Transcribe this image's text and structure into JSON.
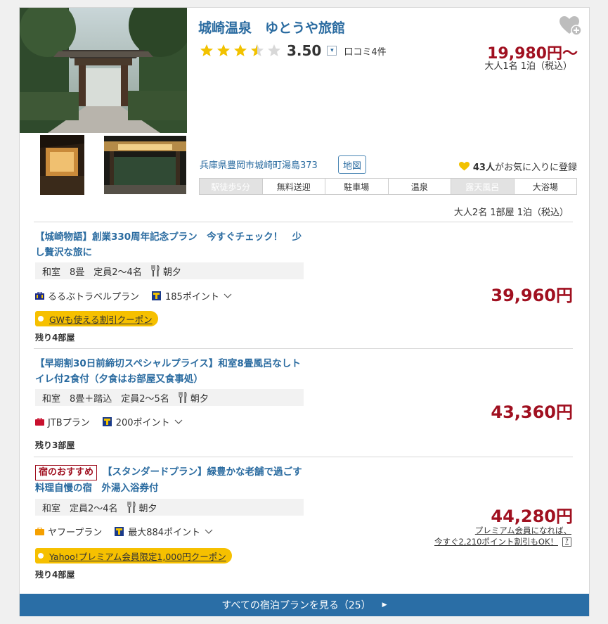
{
  "hotel": {
    "name": "城崎温泉　ゆとうや旅館",
    "rating": {
      "stars": 3.5,
      "score": "3.50",
      "dropdown_glyph": "▾",
      "reviews": "口コミ4件"
    },
    "price_from": "19,980円～",
    "price_note": "大人1名 1泊（税込）",
    "address": "兵庫県豊岡市城崎町湯島373",
    "map_label": "地図",
    "favorites": {
      "count": "43人",
      "suffix": "がお気に入りに登録"
    },
    "amenities": [
      {
        "label": "駅徒歩5分",
        "active": false
      },
      {
        "label": "無料送迎",
        "active": true
      },
      {
        "label": "駐車場",
        "active": true
      },
      {
        "label": "温泉",
        "active": true
      },
      {
        "label": "露天風呂",
        "active": false
      },
      {
        "label": "大浴場",
        "active": true
      }
    ]
  },
  "guest_note": "大人2名 1部屋 1泊（税込）",
  "plans": [
    {
      "badge": "",
      "title": "【城崎物語】創業330周年記念プラン　今すぐチェック！　少し贅沢な旅に",
      "room": "和室　8畳　定員2～4名",
      "meal": "朝夕",
      "provider": "るるぶトラベルプラン",
      "provider_color": "#1a2a8a",
      "points": "185ポイント",
      "coupon": "GWも使える割引クーポン",
      "rooms_left": "残り4部屋",
      "price": "39,960円"
    },
    {
      "badge": "",
      "title": "【早期割30日前締切スペシャルプライス】和室8畳風呂なしトイレ付2食付（夕食はお部屋又食事処）",
      "room": "和室　8畳＋踏込　定員2～5名",
      "meal": "朝夕",
      "provider": "JTBプラン",
      "provider_color": "#c8102e",
      "points": "200ポイント",
      "coupon": "",
      "rooms_left": "残り3部屋",
      "price": "43,360円"
    },
    {
      "badge": "宿のおすすめ",
      "title": "【スタンダードプラン】緑豊かな老舗で過ごす料理自慢の宿　外湯入浴券付",
      "room": "和室　定員2～4名",
      "meal": "朝夕",
      "provider": "ヤフープラン",
      "provider_color": "#f5a000",
      "points": "最大884ポイント",
      "coupon": "Yahoo!プレミアム会員限定1,000円クーポン",
      "rooms_left": "残り4部屋",
      "price": "44,280円",
      "premium_line1": "プレミアム会員になれば、",
      "premium_line2": "今すぐ2,210ポイント割引もOK！",
      "help_glyph": "?"
    }
  ],
  "see_all": {
    "label": "すべての宿泊プランを見る（25）",
    "arrow": "▶"
  },
  "colors": {
    "brand_blue": "#2a6ba0",
    "price_red": "#a01020",
    "coupon_yellow": "#f6c000",
    "footer_blue": "#2a6ea6"
  }
}
